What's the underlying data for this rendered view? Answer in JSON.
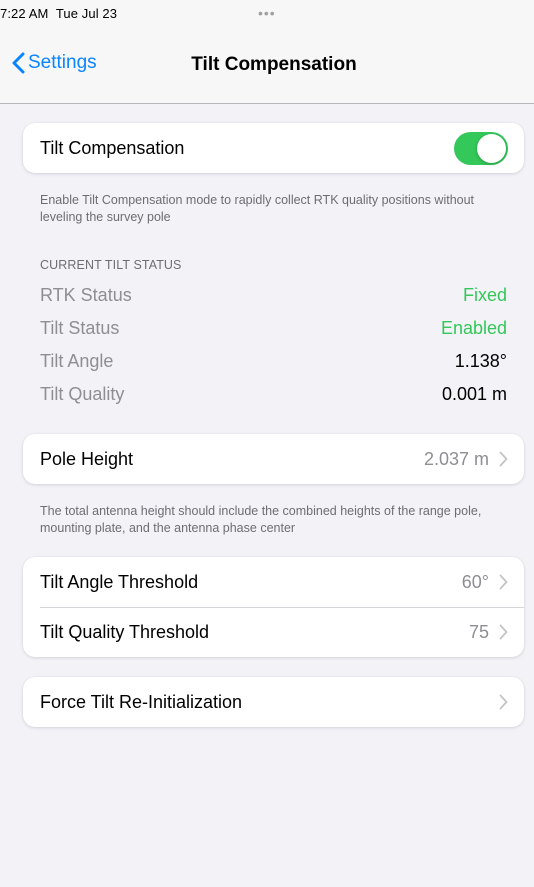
{
  "status_bar": {
    "time": "7:22 AM",
    "date": "Tue Jul 23",
    "dots": "•••"
  },
  "nav": {
    "back_label": "Settings",
    "title": "Tilt Compensation"
  },
  "tilt_toggle": {
    "label": "Tilt Compensation",
    "enabled": true
  },
  "tilt_description": "Enable Tilt Compensation mode to rapidly collect RTK quality positions without leveling the survey pole",
  "current_status": {
    "header": "CURRENT TILT STATUS",
    "rows": [
      {
        "label": "RTK Status",
        "value": "Fixed",
        "color": "#34c759"
      },
      {
        "label": "Tilt Status",
        "value": "Enabled",
        "color": "#34c759"
      },
      {
        "label": "Tilt Angle",
        "value": "1.138°",
        "color": "#000000"
      },
      {
        "label": "Tilt Quality",
        "value": "0.001 m",
        "color": "#000000"
      }
    ]
  },
  "pole_height": {
    "label": "Pole Height",
    "value": "2.037 m"
  },
  "pole_description": "The total antenna height should include the combined heights of the range pole, mounting plate, and the antenna phase center",
  "thresholds": {
    "angle_label": "Tilt Angle Threshold",
    "angle_value": "60°",
    "quality_label": "Tilt Quality Threshold",
    "quality_value": "75"
  },
  "force_reinit": {
    "label": "Force Tilt Re-Initialization"
  },
  "colors": {
    "accent": "#0a84ff",
    "toggle_on": "#34c759",
    "status_green": "#34c759",
    "background": "#f2f2f7"
  }
}
